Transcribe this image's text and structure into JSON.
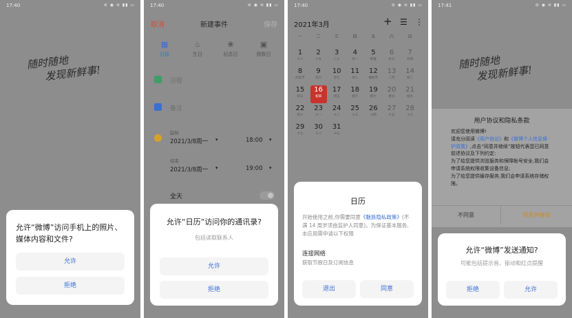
{
  "screens": [
    {
      "status_time": "17:40",
      "status_icons": "⊘ ◉ ≋ ▮▮ ▭",
      "slogan_line1": "随时随地",
      "slogan_line2": "发现新鲜事!",
      "dialog": {
        "title": "允许“微博”访问手机上的照片、媒体内容和文件?",
        "allow": "允许",
        "deny": "拒绝"
      }
    },
    {
      "status_time": "17:40",
      "status_icons": "⊘ ◉ ≋ ▮▮ ▭",
      "header": {
        "cancel": "取消",
        "title": "新建事件",
        "save": "保存"
      },
      "tabs": [
        {
          "icon": "▦",
          "label": "日程"
        },
        {
          "icon": "♨",
          "label": "生日"
        },
        {
          "icon": "❀",
          "label": "纪念日"
        },
        {
          "icon": "▣",
          "label": "倒数日"
        }
      ],
      "schedule_placeholder": "日程",
      "remark_placeholder": "备注",
      "start_label": "起始",
      "start_date": "2021/3/8周一",
      "start_time": "18:00",
      "end_label": "结束",
      "end_date": "2021/3/8周一",
      "end_time": "19:00",
      "allday_label": "全天",
      "dialog": {
        "title": "允许“日历”访问你的通讯录?",
        "sub": "包括读取联系人",
        "allow": "允许",
        "deny": "拒绝"
      }
    },
    {
      "status_time": "17:40",
      "status_icons": "⊘ ◉ ≋ ▮▮ ▭",
      "month_title": "2021年3月",
      "actions": {
        "add": "+",
        "list": "☰",
        "more": "⋮"
      },
      "weekdays": [
        "一",
        "二",
        "三",
        "四",
        "五",
        "六",
        "日"
      ],
      "days": [
        {
          "n": "1",
          "l": "十八"
        },
        {
          "n": "2",
          "l": "十九"
        },
        {
          "n": "3",
          "l": "二十"
        },
        {
          "n": "4",
          "l": "廿一"
        },
        {
          "n": "5",
          "l": "惊蛰"
        },
        {
          "n": "6",
          "l": "廿三"
        },
        {
          "n": "7",
          "l": "廿四"
        },
        {
          "n": "8",
          "l": "妇女节"
        },
        {
          "n": "9",
          "l": "廿六"
        },
        {
          "n": "10",
          "l": "廿七"
        },
        {
          "n": "11",
          "l": "廿八"
        },
        {
          "n": "12",
          "l": "植树节"
        },
        {
          "n": "13",
          "l": "二月"
        },
        {
          "n": "14",
          "l": "初二"
        },
        {
          "n": "15",
          "l": "初三"
        },
        {
          "n": "16",
          "l": "初四"
        },
        {
          "n": "17",
          "l": "初五"
        },
        {
          "n": "18",
          "l": "初六"
        },
        {
          "n": "19",
          "l": "初七"
        },
        {
          "n": "20",
          "l": "春分"
        },
        {
          "n": "21",
          "l": "初九"
        },
        {
          "n": "22",
          "l": "初十"
        },
        {
          "n": "23",
          "l": "十一"
        },
        {
          "n": "24",
          "l": "十二"
        },
        {
          "n": "25",
          "l": "十三"
        },
        {
          "n": "26",
          "l": "十四"
        },
        {
          "n": "27",
          "l": "十五"
        },
        {
          "n": "28",
          "l": "十六"
        },
        {
          "n": "29",
          "l": "十七"
        },
        {
          "n": "30",
          "l": "十八"
        },
        {
          "n": "31",
          "l": "十九"
        }
      ],
      "today": "16",
      "dialog": {
        "title": "日历",
        "body_pre": "开始使用之前,你需要同意",
        "body_link": "《魅族隐私政策》",
        "body_post": "(不满 14 周岁须由监护人同意)。为保证基本服务,本应用需申请以下权限",
        "perm_title": "连接网络",
        "perm_desc": "获取节假日及订阅信息",
        "exit": "退出",
        "agree": "同意"
      }
    },
    {
      "status_time": "17:41",
      "status_icons": "⊘ ◉ ≋ ▮▮ ▭",
      "slogan_line1": "随时随地",
      "slogan_line2": "发现新鲜事!",
      "agreement": {
        "title": "用户协议和隐私条款",
        "welcome": "欢迎您使用微博!",
        "p1_a": "请充分阅读",
        "p1_link1": "《用户协议》",
        "p1_b": "和",
        "p1_link2": "《微博个人信息保护政策》",
        "p1_c": ",点击“同意并继续”按钮代表您已同意前述协议及下列约定:",
        "p2": "为了给您提供浏览服务和保障帐号安全,我们会申请系统权限收集设备信息;",
        "p3": "为了给您提供缓存服务,我们会申请系统存储权限。",
        "disagree": "不同意",
        "agree": "同意并继续"
      },
      "dialog": {
        "title": "允许“微博”发送通知?",
        "sub": "可能包括提示音、振动和红点提醒",
        "deny": "拒绝",
        "allow": "允许"
      }
    }
  ]
}
